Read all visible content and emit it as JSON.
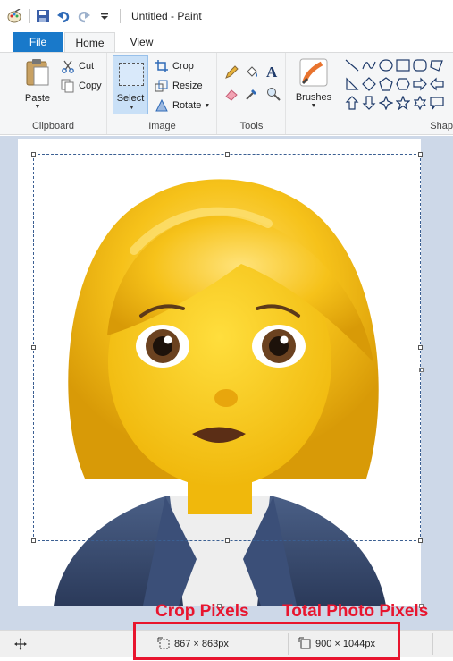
{
  "window": {
    "title": "Untitled - Paint"
  },
  "tabs": {
    "file": "File",
    "home": "Home",
    "view": "View"
  },
  "ribbon": {
    "clipboard": {
      "paste": "Paste",
      "cut": "Cut",
      "copy": "Copy",
      "label": "Clipboard"
    },
    "image": {
      "select": "Select",
      "crop": "Crop",
      "resize": "Resize",
      "rotate": "Rotate",
      "label": "Image"
    },
    "tools": {
      "label": "Tools"
    },
    "brushes": {
      "label": "Brushes"
    },
    "shapes": {
      "label": "Shap"
    }
  },
  "annotations": {
    "crop_pixels": "Crop Pixels",
    "total_pixels": "Total Photo Pixels",
    "highlight_color": "#e8152e"
  },
  "status": {
    "selection_size": "867 × 863px",
    "image_size": "900 × 1044px"
  },
  "colors": {
    "file_tab": "#1979ca",
    "canvas_bg": "#cdd8e8",
    "selection_border": "#3b5f92"
  },
  "canvas_image": {
    "subject": "woman emoji"
  }
}
